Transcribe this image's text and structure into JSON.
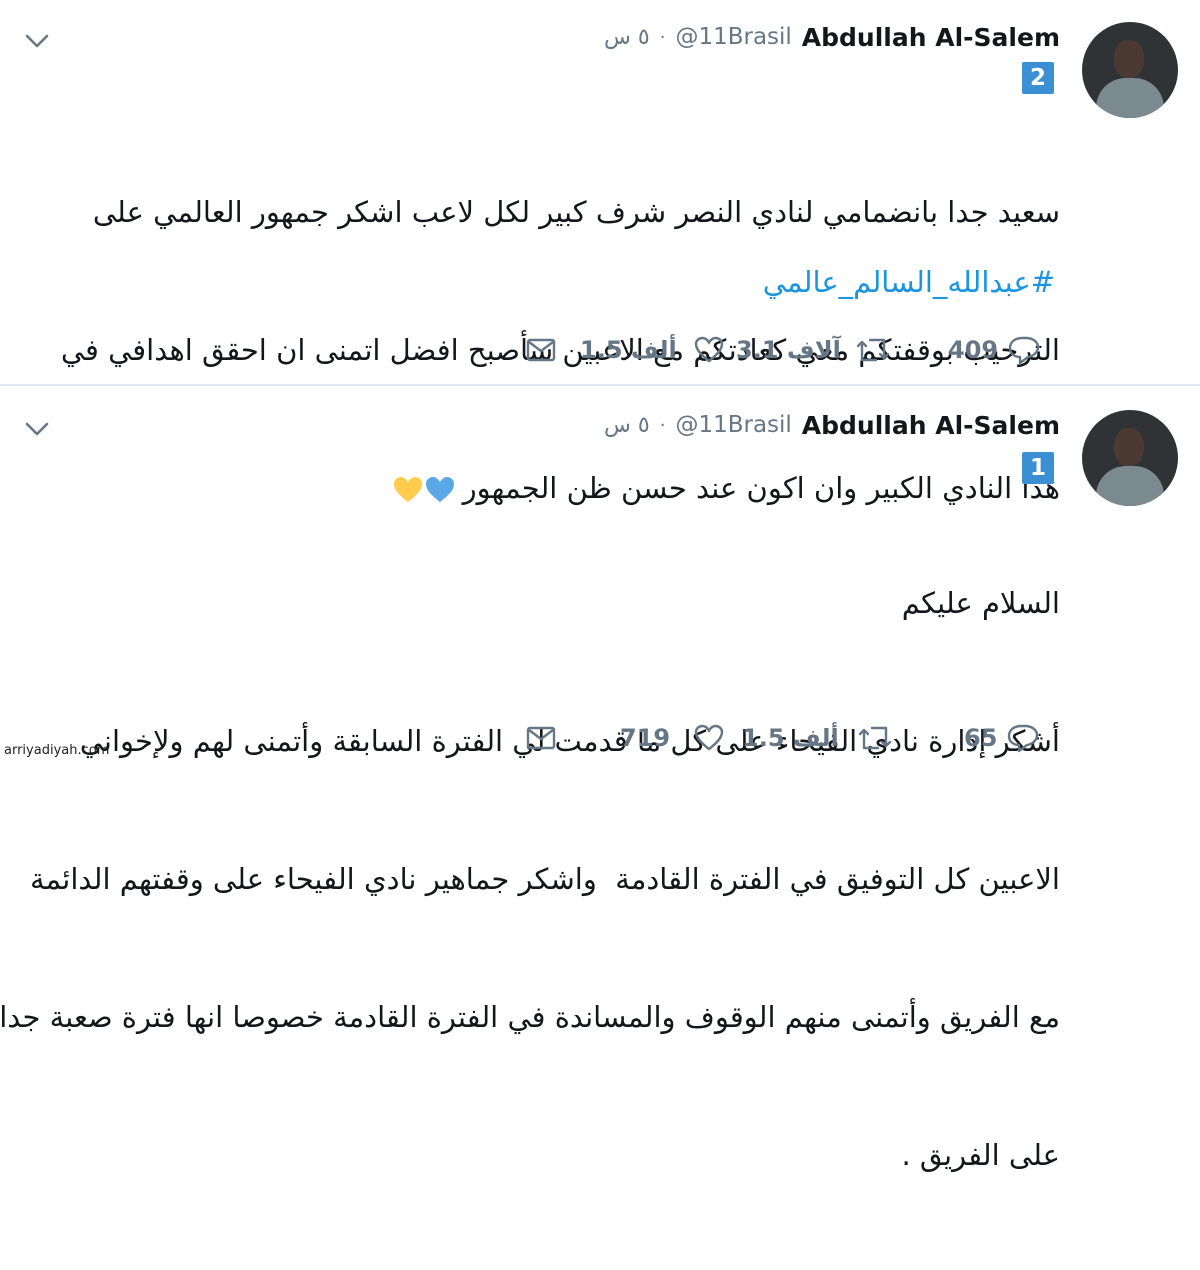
{
  "tweets": [
    {
      "author_name": "Abdullah Al-Salem",
      "handle": "@11Brasil",
      "dot": "·",
      "time": "٥ س",
      "badge": "2",
      "lines": [
        "سعيد جدا بانضمامي لنادي النصر شرف كبير لكل لاعب اشكر جمهور العالمي على",
        "الترحيب بوقفتكم معي كعادتكم مع الاعبين سأصبح افضل اتمنى ان احقق اهدافي في",
        "هذا النادي الكبير وان اكون عند حسن ظن الجمهور"
      ],
      "hashtag": "#عبدالله_السالم_عالمي",
      "replies": "409",
      "retweets": "3.1 آلاف",
      "likes": "1.5 ألف",
      "colors": {
        "heart_blue": "#5aa9e6",
        "heart_yellow": "#ffcc4d"
      }
    },
    {
      "author_name": "Abdullah Al-Salem",
      "handle": "@11Brasil",
      "dot": "·",
      "time": "٥ س",
      "badge": "1",
      "lines": [
        "السلام عليكم",
        "أشكر إدارة نادي الفيحاء على كل ما قدمت لي الفترة السابقة وأتمنى لهم ولإخواني",
        "الاعبين كل التوفيق في الفترة القادمة  واشكر جماهير نادي الفيحاء على وقفتهم الدائمة",
        "مع الفريق وأتمنى منهم الوقوف والمساندة في الفترة القادمة خصوصا انها فترة صعبة جدا",
        "على الفريق ."
      ],
      "replies": "65",
      "retweets": "1.5 ألف",
      "likes": "719"
    }
  ],
  "watermark": "arriyadiyah.com",
  "icons": {
    "reply": "reply-icon",
    "retweet": "retweet-icon",
    "like": "heart-icon",
    "dm": "envelope-icon",
    "menu": "chevron-down-icon"
  },
  "colors": {
    "link": "#1b95e0",
    "muted": "#657786",
    "badge": "#3b8fd3",
    "text": "#14171a"
  }
}
